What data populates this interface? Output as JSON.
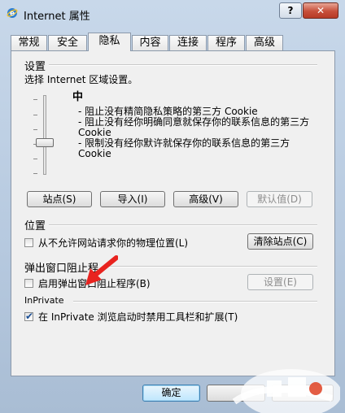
{
  "window": {
    "title": "Internet 属性",
    "help_label": "?",
    "close_label": "✕"
  },
  "tabs": [
    {
      "label": "常规"
    },
    {
      "label": "安全"
    },
    {
      "label": "隐私",
      "active": true
    },
    {
      "label": "内容"
    },
    {
      "label": "连接"
    },
    {
      "label": "程序"
    },
    {
      "label": "高级"
    }
  ],
  "settings": {
    "heading": "设置",
    "instruction": "选择 Internet 区域设置。",
    "level": "中",
    "description_lines": [
      "- 阻止没有精简隐私策略的第三方 Cookie",
      "- 阻止没有经你明确同意就保存你的联系信息的第三方 Cookie",
      "- 限制没有经你默许就保存你的联系信息的第三方 Cookie"
    ],
    "slider_level": "中",
    "buttons": {
      "sites": "站点(S)",
      "import": "导入(I)",
      "advanced": "高级(V)",
      "default": "默认值(D)"
    }
  },
  "location": {
    "heading": "位置",
    "checkbox_label": "从不允许网站请求你的物理位置(L)",
    "checked": false,
    "clear_sites": "清除站点(C)"
  },
  "popup": {
    "heading": "弹出窗口阻止程",
    "checkbox_label": "启用弹出窗口阻止程序(B)",
    "checked": false,
    "settings_button": "设置(E)"
  },
  "inprivate": {
    "heading": "InPrivate",
    "checkbox_label": "在 InPrivate 浏览启动时禁用工具栏和扩展(T)",
    "checked": true
  },
  "footer": {
    "ok": "确定"
  },
  "colors": {
    "annotation_arrow": "#e8231f"
  }
}
